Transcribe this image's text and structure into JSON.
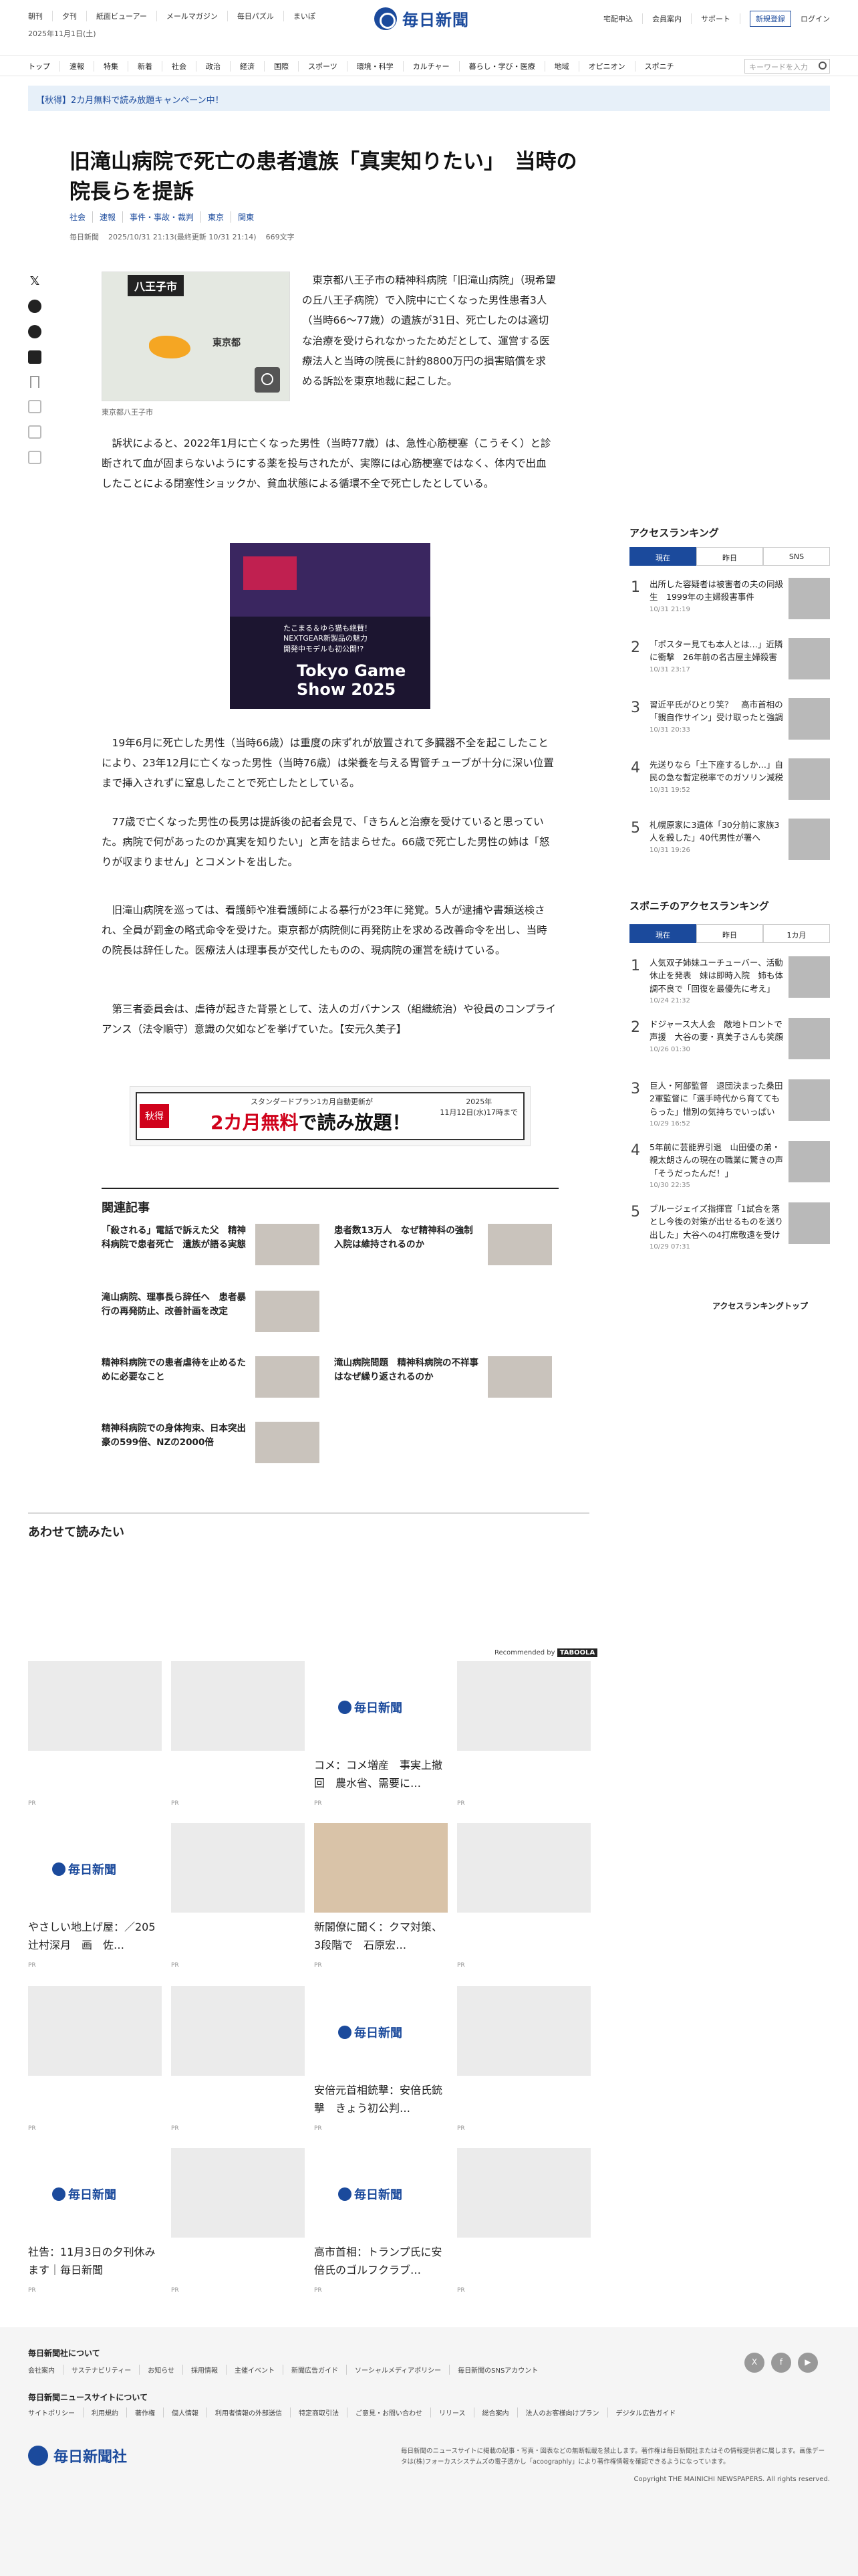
{
  "header": {
    "top_links": [
      "朝刊",
      "夕刊",
      "紙面ビューアー",
      "メールマガジン",
      "毎日パズル",
      "まいぽ"
    ],
    "date": "2025年11月1日(土)",
    "logo_text": "毎日新聞",
    "right_links": [
      "宅配申込",
      "会員案内",
      "サポート"
    ],
    "subscribe": "新規登録",
    "login": "ログイン"
  },
  "nav": {
    "items": [
      "トップ",
      "速報",
      "特集",
      "新着",
      "社会",
      "政治",
      "経済",
      "国際",
      "スポーツ",
      "環境・科学",
      "カルチャー",
      "暮らし・学び・医療",
      "地域",
      "オピニオン",
      "スポニチ"
    ],
    "search_placeholder": "キーワードを入力"
  },
  "banner": "【秋得】2カ月無料で読み放題キャンペーン中！",
  "article": {
    "title": "旧滝山病院で死亡の患者遺族「真実知りたい」　当時の院長らを提訴",
    "tags": [
      "社会",
      "速報",
      "事件・事故・裁判",
      "東京",
      "関東"
    ],
    "meta": [
      "毎日新聞",
      "2025/10/31 21:13(最終更新 10/31 21:14)",
      "669文字"
    ],
    "map": {
      "label": "八王子市",
      "region": "東京都",
      "caption": "東京都八王子市"
    },
    "paragraphs": [
      "東京都八王子市の精神科病院「旧滝山病院」（現希望の丘八王子病院）で入院中に亡くなった男性患者3人（当時66〜77歳）の遺族が31日、死亡したのは適切な治療を受けられなかったためだとして、運営する医療法人と当時の院長に計約8800万円の損害賠償を求める訴訟を東京地裁に起こした。",
      "訴状によると、2022年1月に亡くなった男性（当時77歳）は、急性心筋梗塞（こうそく）と診断されて血が固まらないようにする薬を投与されたが、実際には心筋梗塞ではなく、体内で出血したことによる閉塞性ショックか、貧血状態による循環不全で死亡したとしている。",
      "19年6月に死亡した男性（当時66歳）は重度の床ずれが放置されて多臓器不全を起こしたことにより、23年12月に亡くなった男性（当時76歳）は栄養を与える胃管チューブが十分に深い位置まで挿入されずに窒息したことで死亡したとしている。",
      "77歳で亡くなった男性の長男は提訴後の記者会見で、「きちんと治療を受けていると思っていた。病院で何があったのか真実を知りたい」と声を詰まらせた。66歳で死亡した男性の姉は「怒りが収まりません」とコメントを出した。",
      "旧滝山病院を巡っては、看護師や准看護師による暴行が23年に発覚。5人が逮捕や書類送検され、全員が罰金の略式命令を受けた。東京都が病院側に再発防止を求める改善命令を出し、当時の院長は辞任した。医療法人は理事長が交代したものの、現病院の運営を続けている。",
      "第三者委員会は、虐待が起きた背景として、法人のガバナンス（組織統治）や役員のコンプライアンス（法令順守）意識の欠如などを挙げていた。【安元久美子】"
    ],
    "ad_photo": {
      "sub": "たこまる＆ゆら猫も絶賛！\nNEXTGEAR新製品の魅力\n開発中モデルも初公開!?",
      "title": "Tokyo Game\nShow 2025"
    },
    "promo": {
      "tag": "秋得",
      "small": "スタンダードプラン1カ月自動更新が",
      "big_red": "2カ月無料",
      "big": "で読み放題！",
      "right": "2025年\n11月12日(水)17時まで"
    }
  },
  "related": {
    "heading": "関連記事",
    "items": [
      "「殺される」電話で訴えた父　精神科病院で患者死亡　遺族が語る実態",
      "患者数13万人　なぜ精神科の強制入院は維持されるのか",
      "滝山病院、理事長ら辞任へ　患者暴行の再発防止、改善計画を改定",
      "精神科病院での患者虐待を止めるために必要なこと",
      "滝山病院問題　精神科病院の不祥事はなぜ繰り返されるのか",
      "精神科病院での身体拘束、日本突出　豪の599倍、NZの2000倍"
    ]
  },
  "also_read": {
    "heading": "あわせて読みたい",
    "recommended": "Recommended by",
    "recommended_brand": "TABOOLA",
    "pr": "PR",
    "cards": [
      {
        "title": "",
        "logo": false
      },
      {
        "title": "",
        "logo": false
      },
      {
        "title": "コメ：コメ増産　事実上撤回　農水省、需要に…",
        "logo": true
      },
      {
        "title": "",
        "logo": false
      },
      {
        "title": "やさしい地上げ屋：／205　辻村深月　画　佐…",
        "logo": true
      },
      {
        "title": "",
        "logo": false
      },
      {
        "title": "新閣僚に聞く：クマ対策、3段階で　石原宏…",
        "logo": false
      },
      {
        "title": "",
        "logo": false
      },
      {
        "title": "",
        "logo": false
      },
      {
        "title": "",
        "logo": false
      },
      {
        "title": "安倍元首相銃撃：安倍氏銃撃　きょう初公判…",
        "logo": true
      },
      {
        "title": "",
        "logo": false
      },
      {
        "title": "社告：11月3日の夕刊休みます｜毎日新聞",
        "logo": true
      },
      {
        "title": "",
        "logo": false
      },
      {
        "title": "高市首相：トランプ氏に安倍氏のゴルフクラブ…",
        "logo": true
      },
      {
        "title": "",
        "logo": false
      }
    ]
  },
  "sidebar": {
    "ranking_heading": "アクセスランキング",
    "tabs": [
      "現在",
      "昨日",
      "SNS"
    ],
    "ranking": [
      {
        "title": "出所した容疑者は被害者の夫の同級生　1999年の主婦殺害事件",
        "date": "10/31 21:19"
      },
      {
        "title": "「ポスター見ても本人とは…」近隣に衝撃　26年前の名古屋主婦殺害",
        "date": "10/31 23:17"
      },
      {
        "title": "習近平氏がひとり笑？　高市首相の「親自作サイン」受け取ったと強調",
        "date": "10/31 20:33"
      },
      {
        "title": "先送りなら「土下座するしか…」自民の急な暫定税率でのガソリン減税",
        "date": "10/31 19:52"
      },
      {
        "title": "札幌原家に3遺体「30分前に家族3人を殺した」40代男性が署へ",
        "date": "10/31 19:26"
      }
    ],
    "sponichi_heading": "スポニチのアクセスランキング",
    "sponichi_tabs": [
      "現在",
      "昨日",
      "1カ月"
    ],
    "sponichi": [
      {
        "title": "人気双子姉妹ユーチューバー、活動休止を発表　妹は即時入院　姉も体調不良で「回復を最優先に考え」",
        "date": "10/24 21:32"
      },
      {
        "title": "ドジャース大人会　敵地トロントで声援　大谷の妻・真美子さんも笑顔",
        "date": "10/26 01:30"
      },
      {
        "title": "巨人・阿部監督　退団決まった桑田2軍監督に「選手時代から育ててもらった」惜別の気持ちでいっぱい",
        "date": "10/29 16:52"
      },
      {
        "title": "5年前に芸能界引退　山田優の弟・親太朗さんの現在の職業に驚きの声「そうだったんだ！」",
        "date": "10/30 22:35"
      },
      {
        "title": "ブルージェイズ指揮官「1試合を落とし今後の対策が出せるものを送り出した」大谷への4打席敬遠を受け",
        "date": "10/29 07:31"
      }
    ],
    "ranking_top": "アクセスランキングトップ"
  },
  "footer": {
    "about_heading": "毎日新聞社について",
    "about_links": [
      "会社案内",
      "サステナビリティー",
      "お知らせ",
      "採用情報",
      "主催イベント",
      "新聞広告ガイド",
      "ソーシャルメディアポリシー",
      "毎日新聞のSNSアカウント"
    ],
    "site_heading": "毎日新聞ニュースサイトについて",
    "site_links": [
      "サイトポリシー",
      "利用規約",
      "著作権",
      "個人情報",
      "利用者情報の外部送信",
      "特定商取引法",
      "ご意見・お問い合わせ",
      "リリース",
      "総合案内",
      "法人のお客様向けプラン",
      "デジタル広告ガイド"
    ],
    "social": [
      "X",
      "f",
      "▶"
    ],
    "logo_text": "毎日新聞社",
    "note": "毎日新聞のニュースサイトに掲載の記事・写真・図表などの無断転載を禁止します。著作権は毎日新聞社またはその情報提供者に属します。画像データは(株)フォーカスシステムズの電子透かし「acoographly」により著作権情報を確認できるようになっています。",
    "copyright": "Copyright THE MAINICHI NEWSPAPERS. All rights reserved."
  }
}
